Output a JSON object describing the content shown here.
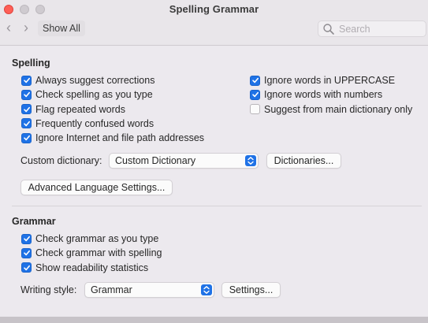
{
  "window": {
    "title": "Spelling  Grammar"
  },
  "toolbar": {
    "back_glyph": "‹",
    "forward_glyph": "›",
    "show_all_label": "Show All",
    "search_placeholder": "Search",
    "search_icon": "search-icon"
  },
  "spelling": {
    "heading": "Spelling",
    "left_options": [
      {
        "label": "Always suggest corrections",
        "checked": true
      },
      {
        "label": "Check spelling as you type",
        "checked": true
      },
      {
        "label": "Flag repeated words",
        "checked": true
      },
      {
        "label": "Frequently confused words",
        "checked": true
      },
      {
        "label": "Ignore Internet and file path addresses",
        "checked": true
      }
    ],
    "right_options": [
      {
        "label": "Ignore words in UPPERCASE",
        "checked": true
      },
      {
        "label": "Ignore words with numbers",
        "checked": true
      },
      {
        "label": "Suggest from main dictionary only",
        "checked": false
      }
    ],
    "custom_dictionary_label": "Custom dictionary:",
    "custom_dictionary_value": "Custom Dictionary",
    "dictionaries_button": "Dictionaries...",
    "advanced_button": "Advanced Language Settings..."
  },
  "grammar": {
    "heading": "Grammar",
    "options": [
      {
        "label": "Check grammar as you type",
        "checked": true
      },
      {
        "label": "Check grammar with spelling",
        "checked": true
      },
      {
        "label": "Show readability statistics",
        "checked": true
      }
    ],
    "writing_style_label": "Writing style:",
    "writing_style_value": "Grammar",
    "settings_button": "Settings..."
  },
  "colors": {
    "accent": "#1f72e6",
    "close": "#fe5f57"
  }
}
